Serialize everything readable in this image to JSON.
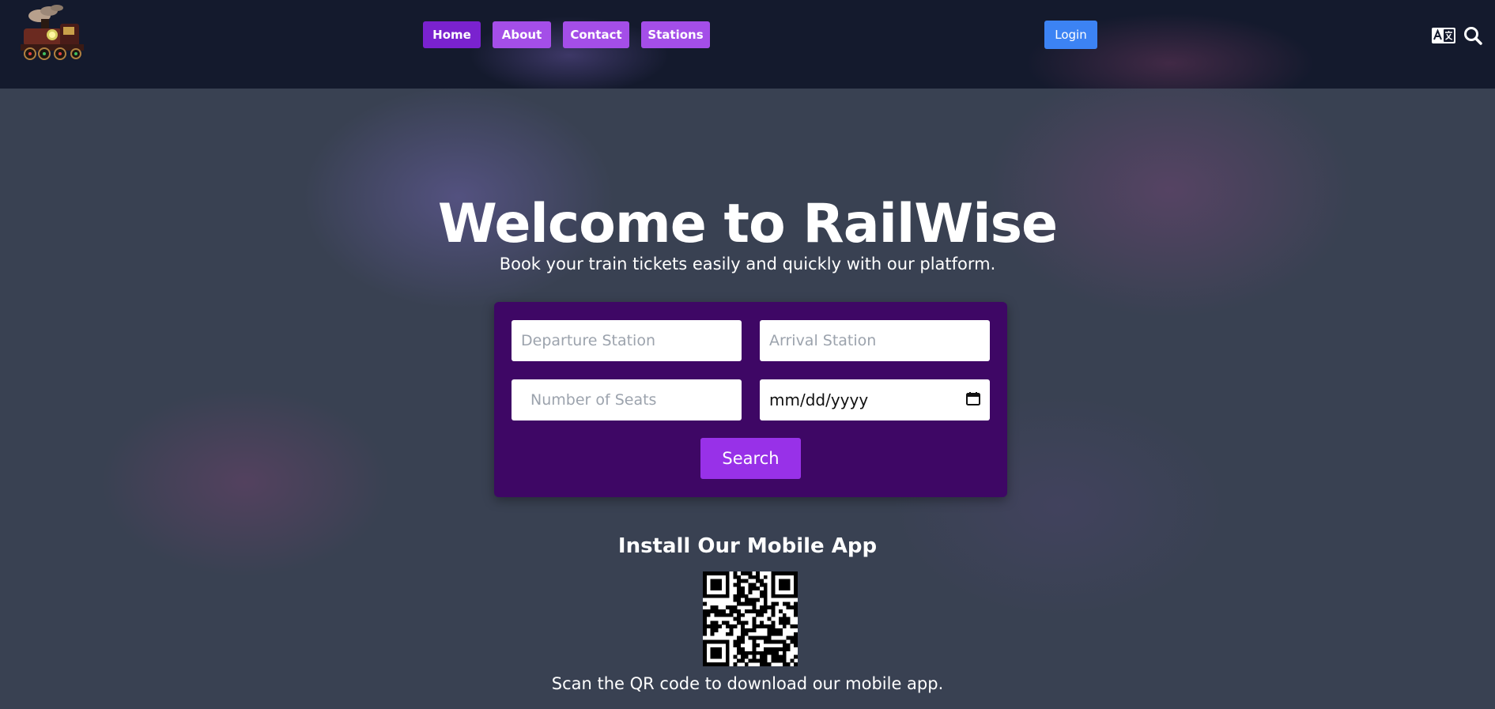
{
  "nav": {
    "items": [
      {
        "label": "Home",
        "active": true
      },
      {
        "label": "About",
        "active": false
      },
      {
        "label": "Contact",
        "active": false
      },
      {
        "label": "Stations",
        "active": false
      }
    ],
    "login_label": "Login",
    "icons": [
      "train-logo",
      "translate-icon",
      "search-icon"
    ]
  },
  "hero": {
    "title": "Welcome to RailWise",
    "subtitle": "Book your train tickets easily and quickly with our platform."
  },
  "search_form": {
    "departure": {
      "placeholder": "Departure Station",
      "value": ""
    },
    "arrival": {
      "placeholder": "Arrival Station",
      "value": ""
    },
    "seats": {
      "placeholder": "Number of Seats",
      "value": ""
    },
    "date": {
      "display": "mm/dd/yyyy",
      "value": ""
    },
    "search_label": "Search"
  },
  "mobile_app": {
    "title": "Install Our Mobile App",
    "subtitle": "Scan the QR code to download our mobile app."
  },
  "colors": {
    "nav_button": "#a44ee8",
    "nav_button_active": "#7a22cf",
    "login_button": "#3c83f4",
    "form_background": "#3e0765",
    "search_button": "#9831e8"
  }
}
